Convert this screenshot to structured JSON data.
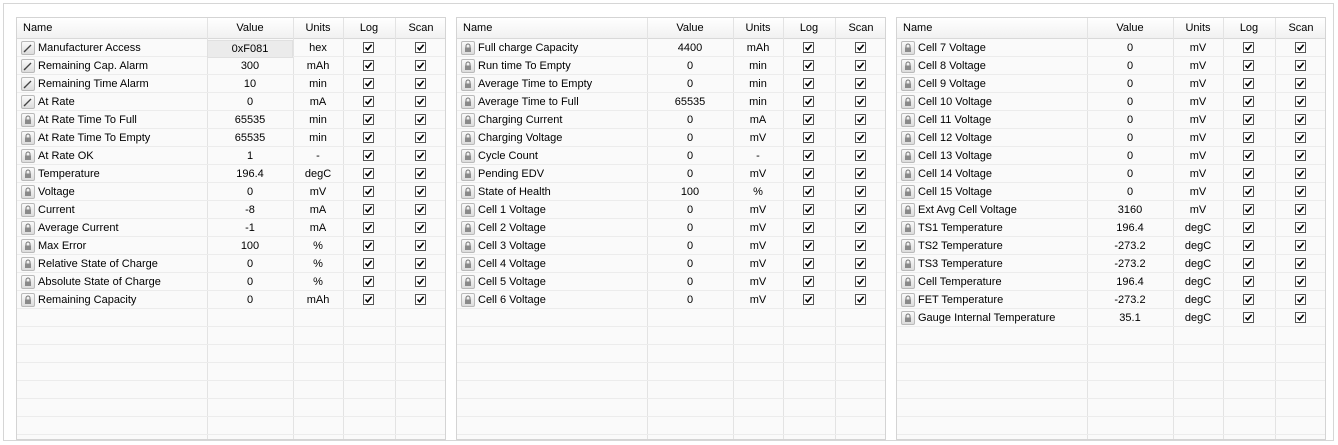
{
  "columns": {
    "name": "Name",
    "value": "Value",
    "units": "Units",
    "log": "Log",
    "scan": "Scan"
  },
  "panels": [
    {
      "rows": [
        {
          "icon": "edit",
          "name": "Manufacturer Access",
          "value": "0xF081",
          "units": "hex",
          "boxed": true
        },
        {
          "icon": "edit",
          "name": "Remaining Cap. Alarm",
          "value": "300",
          "units": "mAh"
        },
        {
          "icon": "edit",
          "name": "Remaining Time Alarm",
          "value": "10",
          "units": "min"
        },
        {
          "icon": "edit",
          "name": "At Rate",
          "value": "0",
          "units": "mA"
        },
        {
          "icon": "lock",
          "name": "At Rate Time To Full",
          "value": "65535",
          "units": "min"
        },
        {
          "icon": "lock",
          "name": "At Rate Time To Empty",
          "value": "65535",
          "units": "min"
        },
        {
          "icon": "lock",
          "name": "At Rate OK",
          "value": "1",
          "units": "-"
        },
        {
          "icon": "lock",
          "name": "Temperature",
          "value": "196.4",
          "units": "degC"
        },
        {
          "icon": "lock",
          "name": "Voltage",
          "value": "0",
          "units": "mV"
        },
        {
          "icon": "lock",
          "name": "Current",
          "value": "-8",
          "units": "mA"
        },
        {
          "icon": "lock",
          "name": "Average Current",
          "value": "-1",
          "units": "mA"
        },
        {
          "icon": "lock",
          "name": "Max Error",
          "value": "100",
          "units": "%"
        },
        {
          "icon": "lock",
          "name": "Relative State of Charge",
          "value": "0",
          "units": "%"
        },
        {
          "icon": "lock",
          "name": "Absolute State of Charge",
          "value": "0",
          "units": "%"
        },
        {
          "icon": "lock",
          "name": "Remaining Capacity",
          "value": "0",
          "units": "mAh"
        }
      ]
    },
    {
      "rows": [
        {
          "icon": "lock",
          "name": "Full charge Capacity",
          "value": "4400",
          "units": "mAh"
        },
        {
          "icon": "lock",
          "name": "Run time To Empty",
          "value": "0",
          "units": "min"
        },
        {
          "icon": "lock",
          "name": "Average Time to Empty",
          "value": "0",
          "units": "min"
        },
        {
          "icon": "lock",
          "name": "Average Time to Full",
          "value": "65535",
          "units": "min"
        },
        {
          "icon": "lock",
          "name": "Charging Current",
          "value": "0",
          "units": "mA"
        },
        {
          "icon": "lock",
          "name": "Charging Voltage",
          "value": "0",
          "units": "mV"
        },
        {
          "icon": "lock",
          "name": "Cycle Count",
          "value": "0",
          "units": "-"
        },
        {
          "icon": "lock",
          "name": "Pending EDV",
          "value": "0",
          "units": "mV"
        },
        {
          "icon": "lock",
          "name": "State of Health",
          "value": "100",
          "units": "%"
        },
        {
          "icon": "lock",
          "name": "Cell 1 Voltage",
          "value": "0",
          "units": "mV"
        },
        {
          "icon": "lock",
          "name": "Cell 2 Voltage",
          "value": "0",
          "units": "mV"
        },
        {
          "icon": "lock",
          "name": "Cell 3 Voltage",
          "value": "0",
          "units": "mV"
        },
        {
          "icon": "lock",
          "name": "Cell 4 Voltage",
          "value": "0",
          "units": "mV"
        },
        {
          "icon": "lock",
          "name": "Cell 5 Voltage",
          "value": "0",
          "units": "mV"
        },
        {
          "icon": "lock",
          "name": "Cell 6 Voltage",
          "value": "0",
          "units": "mV"
        }
      ]
    },
    {
      "rows": [
        {
          "icon": "lock",
          "name": "Cell 7 Voltage",
          "value": "0",
          "units": "mV"
        },
        {
          "icon": "lock",
          "name": "Cell 8 Voltage",
          "value": "0",
          "units": "mV"
        },
        {
          "icon": "lock",
          "name": "Cell 9 Voltage",
          "value": "0",
          "units": "mV"
        },
        {
          "icon": "lock",
          "name": "Cell 10 Voltage",
          "value": "0",
          "units": "mV"
        },
        {
          "icon": "lock",
          "name": "Cell 11 Voltage",
          "value": "0",
          "units": "mV"
        },
        {
          "icon": "lock",
          "name": "Cell 12 Voltage",
          "value": "0",
          "units": "mV"
        },
        {
          "icon": "lock",
          "name": "Cell 13 Voltage",
          "value": "0",
          "units": "mV"
        },
        {
          "icon": "lock",
          "name": "Cell 14 Voltage",
          "value": "0",
          "units": "mV"
        },
        {
          "icon": "lock",
          "name": "Cell 15 Voltage",
          "value": "0",
          "units": "mV"
        },
        {
          "icon": "lock",
          "name": "Ext Avg Cell Voltage",
          "value": "3160",
          "units": "mV"
        },
        {
          "icon": "lock",
          "name": "TS1 Temperature",
          "value": "196.4",
          "units": "degC"
        },
        {
          "icon": "lock",
          "name": "TS2 Temperature",
          "value": "-273.2",
          "units": "degC"
        },
        {
          "icon": "lock",
          "name": "TS3 Temperature",
          "value": "-273.2",
          "units": "degC"
        },
        {
          "icon": "lock",
          "name": "Cell Temperature",
          "value": "196.4",
          "units": "degC"
        },
        {
          "icon": "lock",
          "name": "FET Temperature",
          "value": "-273.2",
          "units": "degC"
        },
        {
          "icon": "lock",
          "name": "Gauge Internal Temperature",
          "value": "35.1",
          "units": "degC"
        }
      ]
    }
  ]
}
